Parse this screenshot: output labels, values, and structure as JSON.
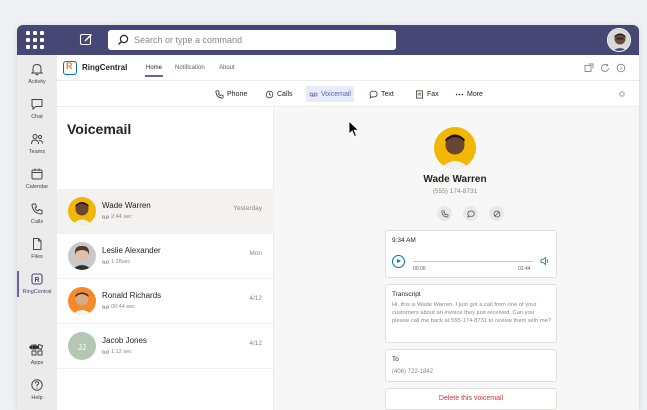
{
  "search": {
    "placeholder": "Search or type a command"
  },
  "rail": {
    "items": [
      {
        "label": "Activity",
        "icon": "bell-icon"
      },
      {
        "label": "Chat",
        "icon": "chat-icon"
      },
      {
        "label": "Teams",
        "icon": "teams-icon"
      },
      {
        "label": "Calendar",
        "icon": "calendar-icon"
      },
      {
        "label": "Calls",
        "icon": "phone-icon"
      },
      {
        "label": "Files",
        "icon": "file-icon"
      },
      {
        "label": "RingCentral",
        "icon": "ringcentral-icon"
      },
      {
        "label": "Apps",
        "icon": "apps-icon"
      },
      {
        "label": "Help",
        "icon": "help-icon"
      }
    ],
    "more": "•••"
  },
  "app": {
    "name": "RingCentral",
    "tabs": [
      "Home",
      "Notification",
      "About"
    ],
    "active_tab": "Home"
  },
  "toolbar": {
    "items": [
      {
        "label": "Phone",
        "icon": "phone-icon"
      },
      {
        "label": "Calls",
        "icon": "clock-icon"
      },
      {
        "label": "Voicemail",
        "icon": "voicemail-icon"
      },
      {
        "label": "Text",
        "icon": "chat-bubble-icon"
      },
      {
        "label": "Fax",
        "icon": "fax-icon"
      },
      {
        "label": "More",
        "icon": "more-dots-icon"
      }
    ],
    "active": "Voicemail"
  },
  "voicemail": {
    "title": "Voicemail",
    "items": [
      {
        "name": "Wade Warren",
        "duration": "2:44 sec",
        "date": "Yesterday"
      },
      {
        "name": "Leslie Alexander",
        "duration": "1:28sec",
        "date": "Mon"
      },
      {
        "name": "Ronald Richards",
        "duration": "00:44 sec",
        "date": "4/12"
      },
      {
        "name": "Jacob Jones",
        "duration": "1:12 sec",
        "date": "4/12",
        "initials": "JJ"
      }
    ]
  },
  "detail": {
    "name": "Wade Warren",
    "phone": "(555) 174-8731",
    "time": "9:34 AM",
    "elapsed": "00:00",
    "total": "02:44",
    "progress": 0.0,
    "transcript_label": "Transcript",
    "transcript": "Hi, this is Wade Warren. I just got a call from one of your customers about an invoice they just received. Can you please call me back at 555-174-8731 to review them with me?",
    "to_label": "To",
    "to_value": "(406) 722-1842",
    "delete_label": "Delete this voicemail"
  },
  "colors": {
    "teams_bar": "#464775",
    "accent": "#6264a7",
    "rc_blue": "#0073ae",
    "rc_orange": "#f58220",
    "delete_red": "#d13438"
  }
}
